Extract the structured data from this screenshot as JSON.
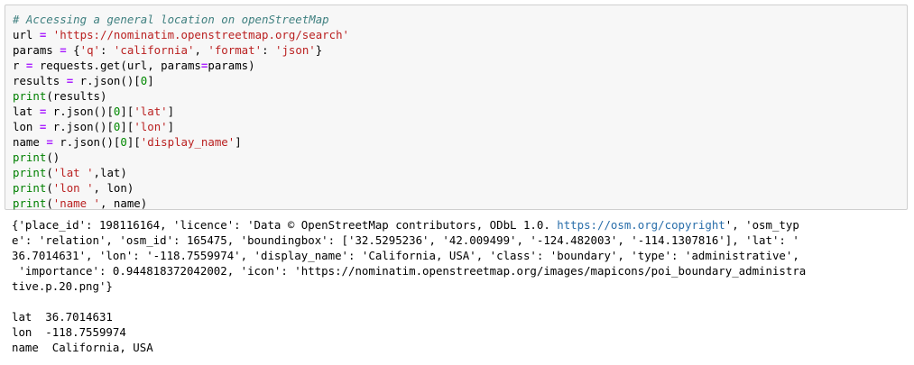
{
  "code_cell": {
    "lines": [
      [
        {
          "t": "comment",
          "v": "# Accessing a general location on openStreetMap"
        }
      ],
      [
        {
          "t": "var",
          "v": "url "
        },
        {
          "t": "op",
          "v": "="
        },
        {
          "t": "var",
          "v": " "
        },
        {
          "t": "str",
          "v": "'https://nominatim.openstreetmap.org/search'"
        }
      ],
      [
        {
          "t": "var",
          "v": "params "
        },
        {
          "t": "op",
          "v": "="
        },
        {
          "t": "var",
          "v": " {"
        },
        {
          "t": "str",
          "v": "'q'"
        },
        {
          "t": "var",
          "v": ": "
        },
        {
          "t": "str",
          "v": "'california'"
        },
        {
          "t": "var",
          "v": ", "
        },
        {
          "t": "str",
          "v": "'format'"
        },
        {
          "t": "var",
          "v": ": "
        },
        {
          "t": "str",
          "v": "'json'"
        },
        {
          "t": "var",
          "v": "}"
        }
      ],
      [
        {
          "t": "var",
          "v": "r "
        },
        {
          "t": "op",
          "v": "="
        },
        {
          "t": "var",
          "v": " requests.get(url, params"
        },
        {
          "t": "op",
          "v": "="
        },
        {
          "t": "var",
          "v": "params)"
        }
      ],
      [
        {
          "t": "var",
          "v": "results "
        },
        {
          "t": "op",
          "v": "="
        },
        {
          "t": "var",
          "v": " r.json()["
        },
        {
          "t": "num",
          "v": "0"
        },
        {
          "t": "var",
          "v": "]"
        }
      ],
      [
        {
          "t": "builtin",
          "v": "print"
        },
        {
          "t": "var",
          "v": "(results)"
        }
      ],
      [
        {
          "t": "var",
          "v": "lat "
        },
        {
          "t": "op",
          "v": "="
        },
        {
          "t": "var",
          "v": " r.json()["
        },
        {
          "t": "num",
          "v": "0"
        },
        {
          "t": "var",
          "v": "]["
        },
        {
          "t": "str",
          "v": "'lat'"
        },
        {
          "t": "var",
          "v": "]"
        }
      ],
      [
        {
          "t": "var",
          "v": "lon "
        },
        {
          "t": "op",
          "v": "="
        },
        {
          "t": "var",
          "v": " r.json()["
        },
        {
          "t": "num",
          "v": "0"
        },
        {
          "t": "var",
          "v": "]["
        },
        {
          "t": "str",
          "v": "'lon'"
        },
        {
          "t": "var",
          "v": "]"
        }
      ],
      [
        {
          "t": "var",
          "v": "name "
        },
        {
          "t": "op",
          "v": "="
        },
        {
          "t": "var",
          "v": " r.json()["
        },
        {
          "t": "num",
          "v": "0"
        },
        {
          "t": "var",
          "v": "]["
        },
        {
          "t": "str",
          "v": "'display_name'"
        },
        {
          "t": "var",
          "v": "]"
        }
      ],
      [
        {
          "t": "builtin",
          "v": "print"
        },
        {
          "t": "var",
          "v": "()"
        }
      ],
      [
        {
          "t": "builtin",
          "v": "print"
        },
        {
          "t": "var",
          "v": "("
        },
        {
          "t": "str",
          "v": "'lat '"
        },
        {
          "t": "var",
          "v": ",lat)"
        }
      ],
      [
        {
          "t": "builtin",
          "v": "print"
        },
        {
          "t": "var",
          "v": "("
        },
        {
          "t": "str",
          "v": "'lon '"
        },
        {
          "t": "var",
          "v": ", lon)"
        }
      ],
      [
        {
          "t": "builtin",
          "v": "print"
        },
        {
          "t": "var",
          "v": "("
        },
        {
          "t": "str",
          "v": "'name '"
        },
        {
          "t": "var",
          "v": ", name)"
        }
      ]
    ]
  },
  "output_cell": {
    "lines": [
      [
        {
          "t": "text",
          "v": "{'place_id': 198116164, 'licence': 'Data © OpenStreetMap contributors, ODbL 1.0. "
        },
        {
          "t": "link",
          "v": "https://osm.org/copyright"
        },
        {
          "t": "text",
          "v": "', 'osm_typ"
        }
      ],
      [
        {
          "t": "text",
          "v": "e': 'relation', 'osm_id': 165475, 'boundingbox': ['32.5295236', '42.009499', '-124.482003', '-114.1307816'], 'lat': '"
        }
      ],
      [
        {
          "t": "text",
          "v": "36.7014631', 'lon': '-118.7559974', 'display_name': 'California, USA', 'class': 'boundary', 'type': 'administrative',"
        }
      ],
      [
        {
          "t": "text",
          "v": " 'importance': 0.944818372042002, 'icon': 'https://nominatim.openstreetmap.org/images/mapicons/poi_boundary_administra"
        }
      ],
      [
        {
          "t": "text",
          "v": "tive.p.20.png'}"
        }
      ],
      [],
      [
        {
          "t": "text",
          "v": "lat  36.7014631"
        }
      ],
      [
        {
          "t": "text",
          "v": "lon  -118.7559974"
        }
      ],
      [
        {
          "t": "text",
          "v": "name  California, USA"
        }
      ]
    ]
  },
  "colors": {
    "input_background": "#f7f7f7",
    "input_border": "#cfcfcf",
    "comment": "#408080",
    "string": "#ba2121",
    "number": "#008800",
    "operator": "#aa22ff",
    "builtin": "#008000",
    "link": "#296eaa"
  }
}
